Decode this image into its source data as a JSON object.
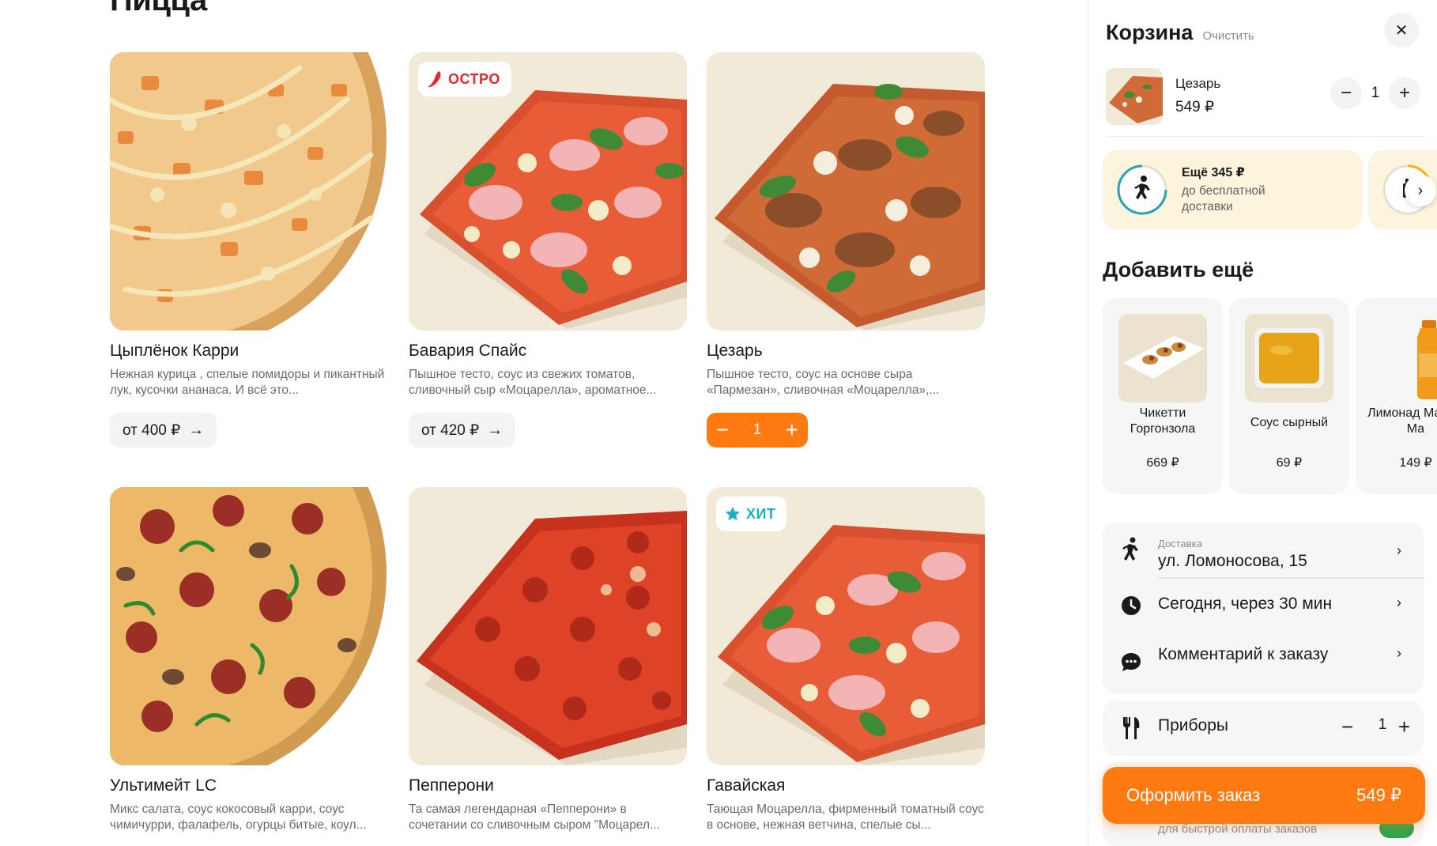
{
  "catalog": {
    "section_title": "Пицца",
    "products": [
      {
        "name": "Цыплёнок Карри",
        "desc": "Нежная курица , спелые помидоры и пикантный лук, кусочки ананаса. И всё это...",
        "price": "от 400 ₽",
        "badge": null
      },
      {
        "name": "Бавария Спайс",
        "desc": "Пышное тесто, соус из свежих томатов, сливочный сыр «Моцарелла», ароматное...",
        "price": "от 420 ₽",
        "badge": "ОСТРО"
      },
      {
        "name": "Цезарь",
        "desc": "Пышное тесто, соус на основе сыра «Пармезан», сливочная «Моцарелла»,...",
        "quantity": "1",
        "badge": null
      },
      {
        "name": "Ультимейт LC",
        "desc": "Микс салата, соус кокосовый карри, соус чимичурри, фалафель, огурцы битые, коул...",
        "badge": null
      },
      {
        "name": "Пепперони",
        "desc": "Та самая легендарная «Пепперони» в сочетании со сливочным сыром \"Моцарел...",
        "badge": null
      },
      {
        "name": "Гавайская",
        "desc": "Тающая Моцарелла, фирменный томатный соус в основе, нежная ветчина, спелые сы...",
        "badge": "ХИТ"
      }
    ],
    "icons": {
      "hot": "chili-icon",
      "hit": "star-icon",
      "arrow": "arrow-right-icon"
    },
    "colors": {
      "accent": "#ff7a10",
      "hot": "#e8262f",
      "hit": "#1fb0c6"
    }
  },
  "cart": {
    "title": "Корзина",
    "clear_label": "Очистить",
    "item": {
      "name": "Цезарь",
      "price": "549 ₽",
      "quantity": "1"
    },
    "promos": [
      {
        "main": "Ещё 345 ₽",
        "sub": "до бесплатной доставки"
      }
    ],
    "add_more_title": "Добавить ещё",
    "upsell": [
      {
        "name": "Чикетти Горгонзола",
        "price": "669 ₽"
      },
      {
        "name": "Соус сырный",
        "price": "69 ₽"
      },
      {
        "name": "Лимонад Манго-Ма",
        "price": "149 ₽"
      }
    ],
    "delivery": {
      "small_label": "Доставка",
      "address": "ул. Ломоносова, 15"
    },
    "time_label": "Сегодня, через 30 мин",
    "comment_label": "Комментарий к заказу",
    "cutlery": {
      "label": "Приборы",
      "quantity": "1"
    },
    "hidden_hint": "для быстрой оплаты заказов",
    "checkout": {
      "label": "Оформить заказ",
      "total": "549 ₽"
    }
  }
}
